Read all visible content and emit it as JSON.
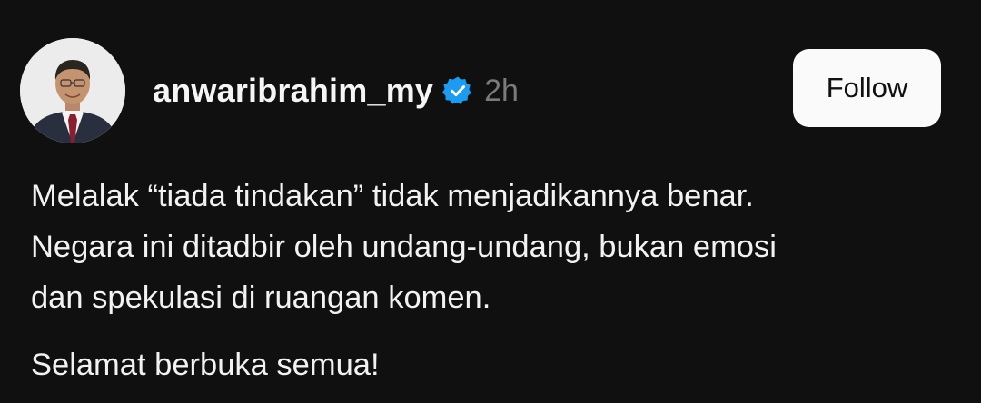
{
  "post": {
    "username": "anwaribrahim_my",
    "verified_icon": "verified-badge-icon",
    "time_ago": "2h",
    "follow_label": "Follow",
    "paragraphs": [
      {
        "lines": [
          "Melalak “tiada tindakan” tidak menjadikannya benar.",
          "Negara ini ditadbir oleh undang-undang, bukan emosi",
          "dan spekulasi di ruangan komen."
        ]
      },
      {
        "lines": [
          "Selamat berbuka semua!"
        ]
      }
    ]
  },
  "colors": {
    "background": "#101010",
    "text": "#f2f2f2",
    "muted": "#7a7a7a",
    "verified": "#1d9bf0",
    "button_bg": "#fafafa",
    "button_text": "#111111"
  }
}
